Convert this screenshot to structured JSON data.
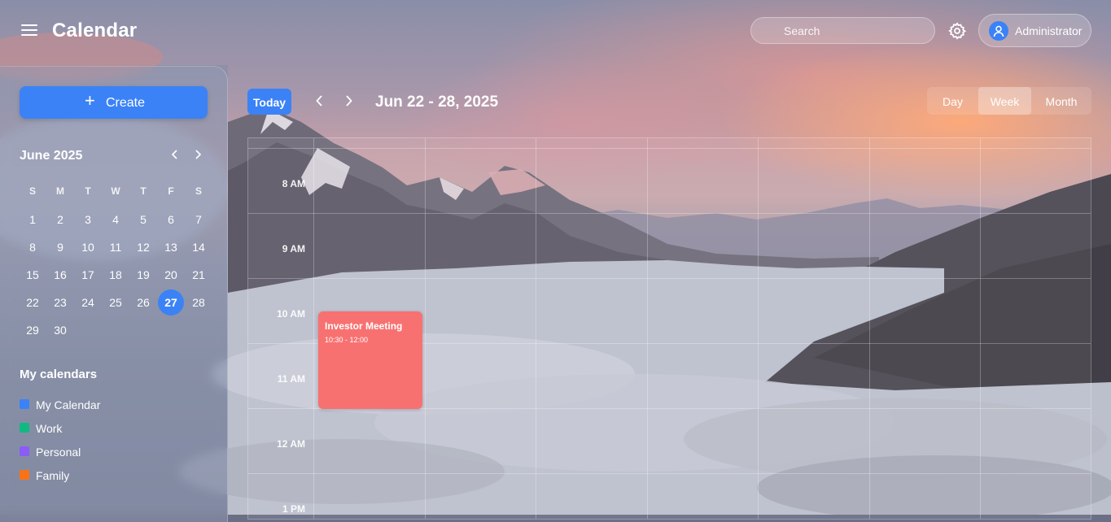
{
  "app": {
    "title": "Calendar"
  },
  "header": {
    "search_placeholder": "Search",
    "user_name": "Administrator"
  },
  "sidebar": {
    "create_label": "Create",
    "mini_calendar": {
      "title": "June 2025",
      "weekdays": [
        "S",
        "M",
        "T",
        "W",
        "T",
        "F",
        "S"
      ],
      "weeks": [
        [
          "1",
          "2",
          "3",
          "4",
          "5",
          "6",
          "7"
        ],
        [
          "8",
          "9",
          "10",
          "11",
          "12",
          "13",
          "14"
        ],
        [
          "15",
          "16",
          "17",
          "18",
          "19",
          "20",
          "21"
        ],
        [
          "22",
          "23",
          "24",
          "25",
          "26",
          "27",
          "28"
        ],
        [
          "29",
          "30"
        ]
      ],
      "today": "27"
    },
    "my_calendars_title": "My calendars",
    "calendars": [
      {
        "name": "My Calendar",
        "color": "#3b82f6"
      },
      {
        "name": "Work",
        "color": "#10b981"
      },
      {
        "name": "Personal",
        "color": "#8b5cf6"
      },
      {
        "name": "Family",
        "color": "#f97316"
      }
    ]
  },
  "toolbar": {
    "today_label": "Today",
    "date_range": "Jun 22 - 28, 2025",
    "views": [
      "Day",
      "Week",
      "Month"
    ],
    "active_view": "Week"
  },
  "week_grid": {
    "hours": [
      "8 AM",
      "9 AM",
      "10 AM",
      "11 AM",
      "12 AM",
      "1 PM"
    ],
    "events": [
      {
        "title": "Investor Meeting",
        "time": "10:30 - 12:00",
        "color": "#f87171"
      }
    ]
  }
}
